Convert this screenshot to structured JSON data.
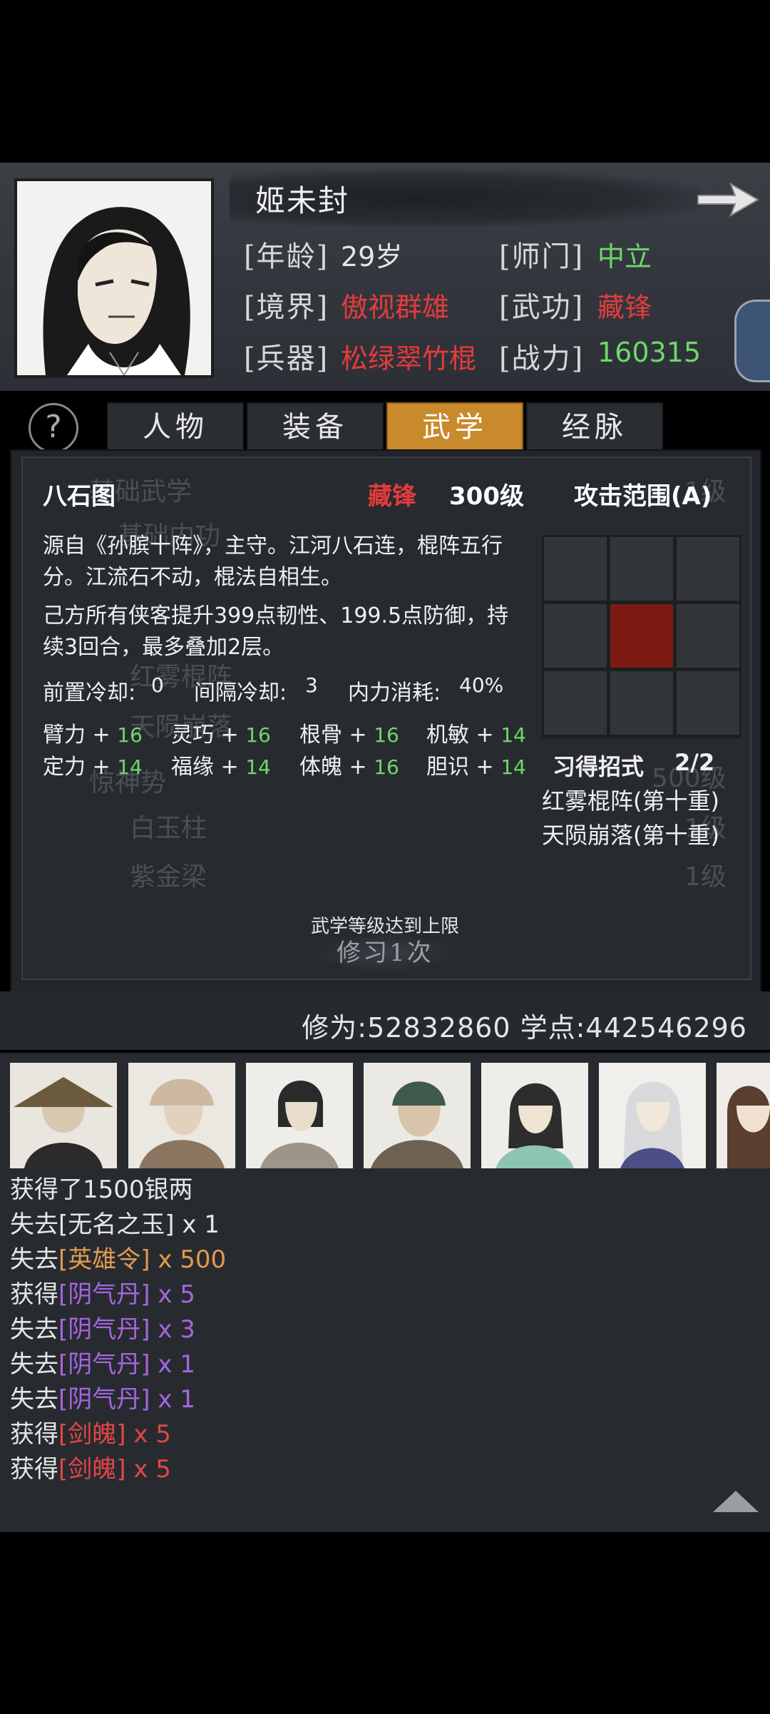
{
  "character": {
    "name": "姬未封",
    "fields": [
      {
        "label": "[年龄]",
        "value": "29岁"
      },
      {
        "label": "[师门]",
        "value": "中立"
      },
      {
        "label": "[境界]",
        "value": "傲视群雄"
      },
      {
        "label": "[武功]",
        "value": "藏锋"
      },
      {
        "label": "[兵器]",
        "value": "松绿翠竹棍"
      },
      {
        "label": "[战力]",
        "value": "160315"
      }
    ]
  },
  "tabs": [
    "人物",
    "装备",
    "武学",
    "经脉"
  ],
  "active_tab": "武学",
  "help_symbol": "?",
  "background_list": [
    "基础武学",
    "基础内功",
    "红雾棍阵",
    "天陨崩落",
    "惊神势",
    "白玉柱",
    "紫金梁"
  ],
  "background_levels": [
    "1级",
    "500级",
    "1级",
    "1级"
  ],
  "skill": {
    "name": "八石图",
    "type": "藏锋",
    "level": "300级",
    "range": "攻击范围(A)",
    "description": "源自《孙膑十阵》，主守。江河八石连，棍阵五行分。江流石不动，棍法自相生。",
    "effect": "己方所有侠客提升399点韧性、199.5点防御，持续3回合，最多叠加2层。",
    "cooldowns": [
      {
        "label": "前置冷却:",
        "value": "0"
      },
      {
        "label": "间隔冷却:",
        "value": "3"
      },
      {
        "label": "内力消耗:",
        "value": "40%"
      }
    ],
    "stats": [
      {
        "label": "臂力",
        "value": "16"
      },
      {
        "label": "灵巧",
        "value": "16"
      },
      {
        "label": "根骨",
        "value": "16"
      },
      {
        "label": "机敏",
        "value": "14"
      },
      {
        "label": "定力",
        "value": "14"
      },
      {
        "label": "福缘",
        "value": "14"
      },
      {
        "label": "体魄",
        "value": "16"
      },
      {
        "label": "胆识",
        "value": "14"
      }
    ],
    "learned_label": "习得招式",
    "learned_count": "2/2",
    "moves": [
      "红雾棍阵(第十重)",
      "天陨崩落(第十重)"
    ],
    "max_note": "武学等级达到上限",
    "practice_button": "修习1次"
  },
  "cultivation": "修为:52832860  学点:442546296",
  "log": [
    {
      "verb": "获得了1500银两",
      "item": "",
      "qty": "",
      "color": ""
    },
    {
      "verb": "失去",
      "item": "[无名之玉]",
      "qty": "x 1",
      "color": "#e6e6e6"
    },
    {
      "verb": "失去",
      "item": "[英雄令]",
      "qty": "x 500",
      "color": "#e39a4e"
    },
    {
      "verb": "获得",
      "item": "[阴气丹]",
      "qty": "x 5",
      "color": "#a765e0"
    },
    {
      "verb": "失去",
      "item": "[阴气丹]",
      "qty": "x 3",
      "color": "#a765e0"
    },
    {
      "verb": "失去",
      "item": "[阴气丹]",
      "qty": "x 1",
      "color": "#a765e0"
    },
    {
      "verb": "失去",
      "item": "[阴气丹]",
      "qty": "x 1",
      "color": "#a765e0"
    },
    {
      "verb": "获得",
      "item": "[剑魄]",
      "qty": "x 5",
      "color": "#e24646"
    },
    {
      "verb": "获得",
      "item": "[剑魄]",
      "qty": "x 5",
      "color": "#e24646"
    }
  ]
}
